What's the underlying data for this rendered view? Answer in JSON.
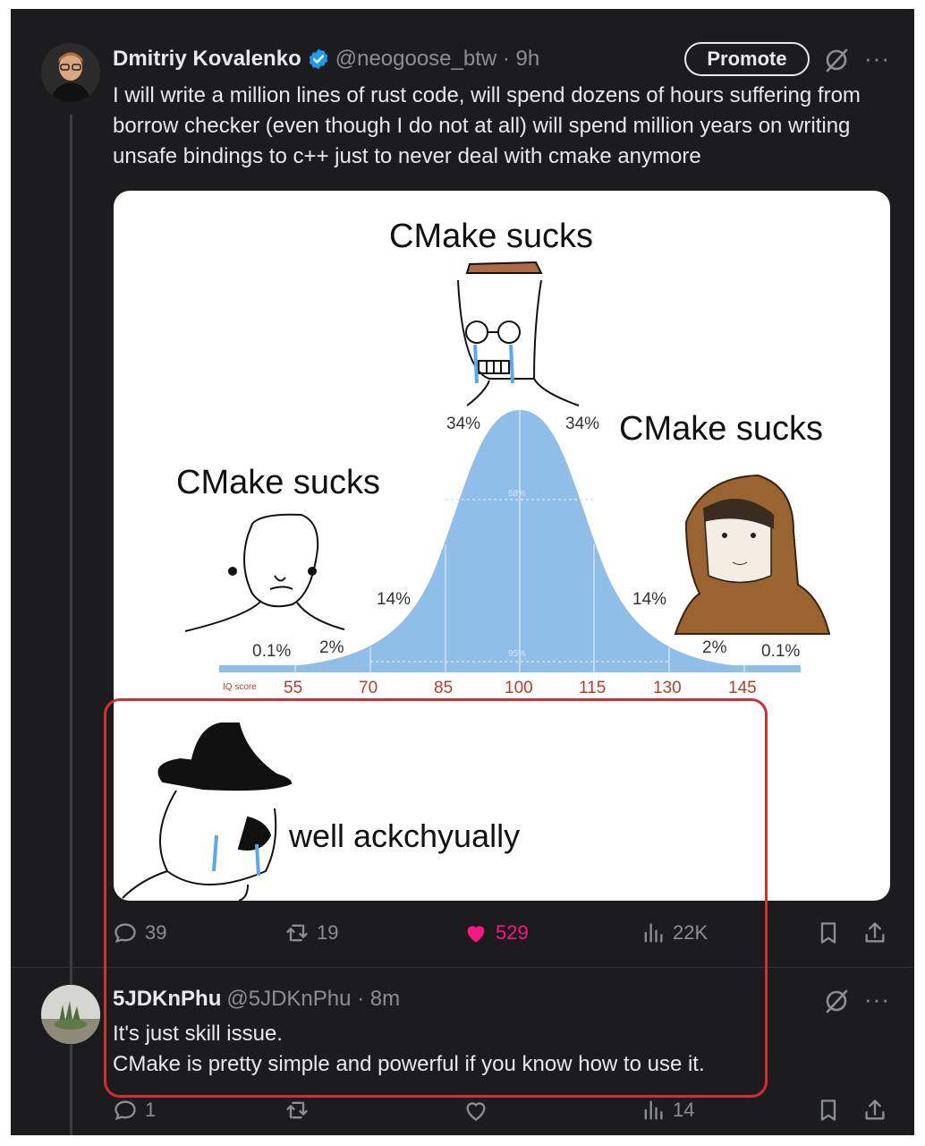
{
  "tweet": {
    "author_name": "Dmitriy Kovalenko",
    "author_handle": "@neogoose_btw · 9h",
    "promote_label": "Promote",
    "more": "···",
    "text": "I will write a million lines of rust code, will spend dozens of hours suffering from borrow checker (even though I do not at all) will spend million years on writing unsafe bindings to c++ just to never deal with cmake anymore",
    "meme": {
      "caption_top": "CMake sucks",
      "caption_left": "CMake sucks",
      "caption_right": "CMake sucks",
      "caption_bottom": "well ackchyually",
      "pct_labels": [
        "0.1%",
        "2%",
        "14%",
        "34%",
        "34%",
        "14%",
        "2%",
        "0.1%"
      ],
      "inner_labels": [
        "68%",
        "95%"
      ],
      "iq_label": "IQ score",
      "iq_ticks": [
        "55",
        "70",
        "85",
        "100",
        "115",
        "130",
        "145"
      ]
    },
    "stats": {
      "replies": "39",
      "retweets": "19",
      "likes": "529",
      "views": "22K"
    }
  },
  "reply": {
    "author_name": "5JDKnPhu",
    "author_handle": "@5JDKnPhu · 8m",
    "more": "···",
    "line1": "It's just skill issue.",
    "line2": "CMake is pretty simple and powerful if you know how to use it.",
    "stats": {
      "replies": "1",
      "retweets": "",
      "likes": "",
      "views": "14"
    }
  },
  "colors": {
    "background": "#1c1c1e",
    "text": "#e7e9ea",
    "muted": "#8b8f94",
    "like": "#f91880",
    "verified": "#1d9bf0",
    "highlight": "#d32f2f",
    "curve": "#8fbfe8"
  }
}
